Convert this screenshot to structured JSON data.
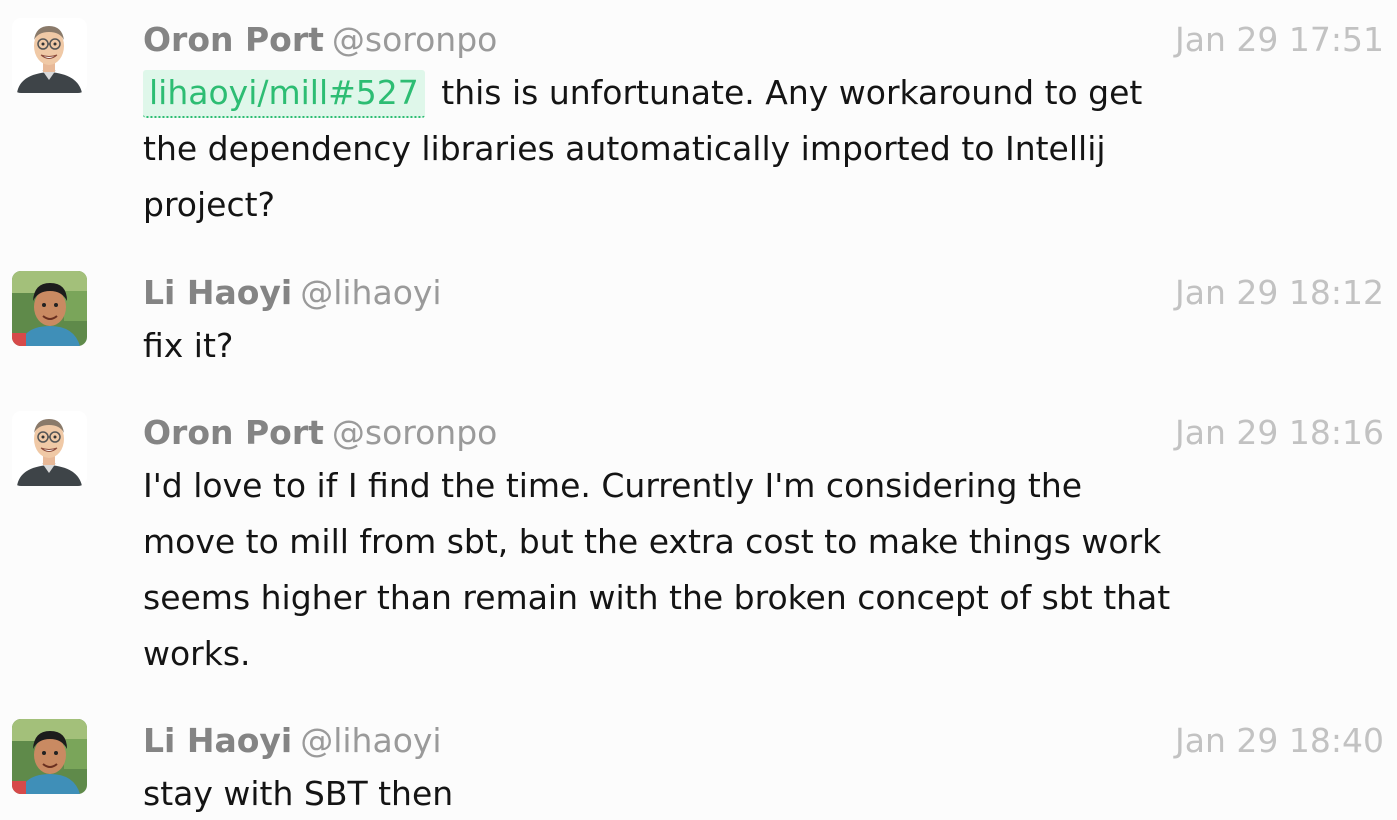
{
  "messages": [
    {
      "name": "Oron Port",
      "username": "@soronpo",
      "time": "Jan 29 17:51",
      "link": "lihaoyi/mill#527",
      "text": "this is unfortunate. Any workaround to get the dependency libraries automatically imported to Intellij project?",
      "avatar": "cartoon-avatar-icon"
    },
    {
      "name": "Li Haoyi",
      "username": "@lihaoyi",
      "time": "Jan 29 18:12",
      "text": "fix it?",
      "avatar": "photo-avatar-icon"
    },
    {
      "name": "Oron Port",
      "username": "@soronpo",
      "time": "Jan 29 18:16",
      "text": "I'd love to if I find the time. Currently I'm considering the move to mill from sbt, but the extra cost to make things work seems higher than remain with the broken concept of sbt that works.",
      "avatar": "cartoon-avatar-icon"
    },
    {
      "name": "Li Haoyi",
      "username": "@lihaoyi",
      "time": "Jan 29 18:40",
      "text": "stay with SBT then",
      "avatar": "photo-avatar-icon"
    }
  ],
  "colors": {
    "background": "#fcfcfc",
    "name": "#848484",
    "username": "#9a9a9a",
    "timestamp": "#c2c2c2",
    "text": "#141414",
    "link": "#2dbd73",
    "link_bg": "#dff7ea"
  }
}
